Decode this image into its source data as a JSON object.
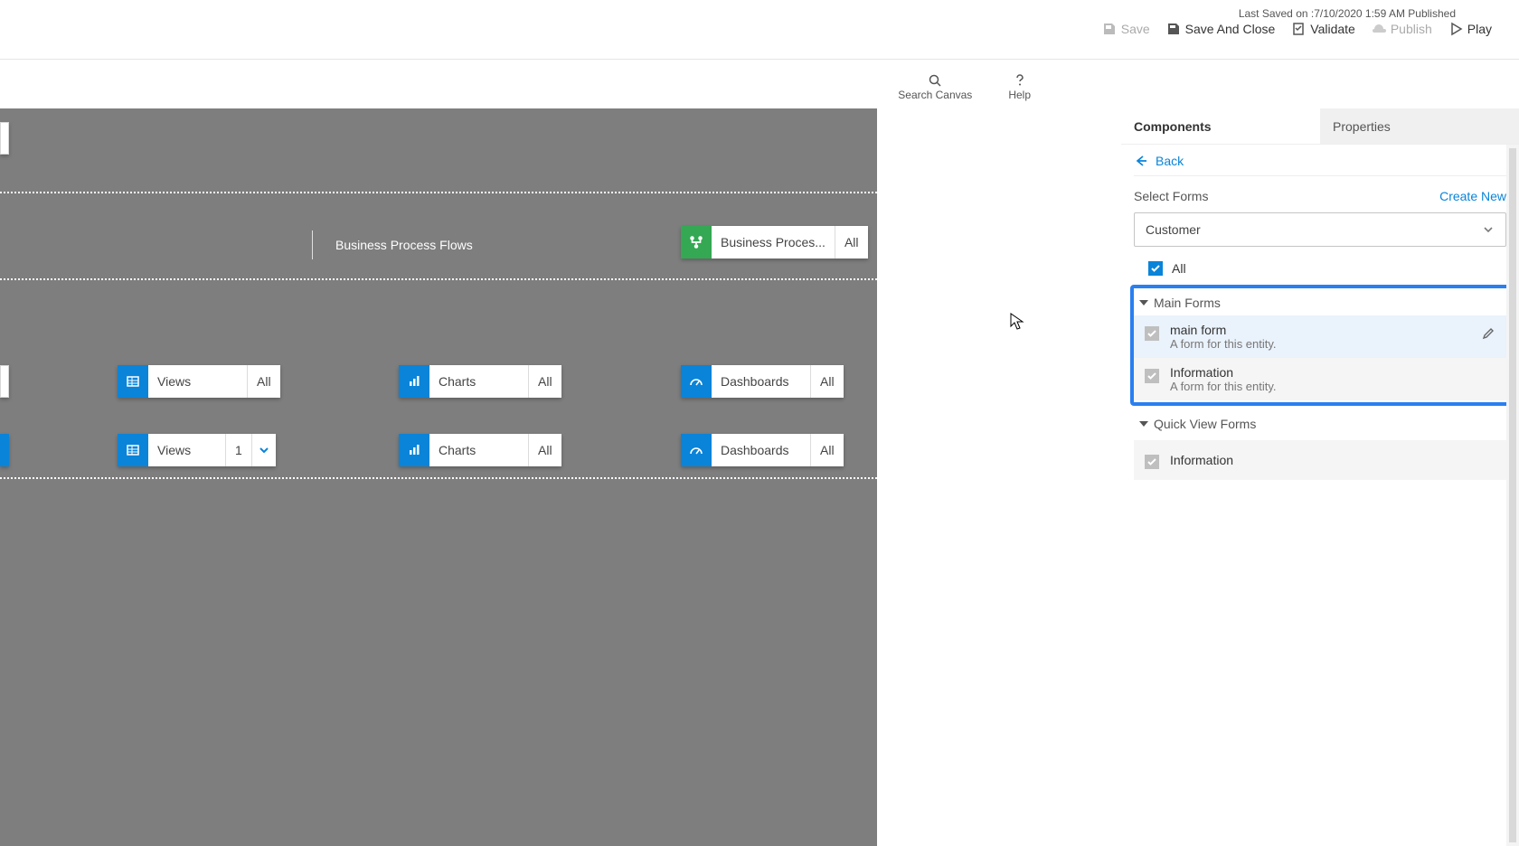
{
  "status_line": "Last Saved on :7/10/2020 1:59 AM Published",
  "toolbar": {
    "save": "Save",
    "save_and_close": "Save And Close",
    "validate": "Validate",
    "publish": "Publish",
    "play": "Play"
  },
  "secondary": {
    "search_canvas": "Search Canvas",
    "help": "Help"
  },
  "canvas": {
    "bpf_label": "Business Process Flows",
    "bpf_tile": {
      "label": "Business Proces...",
      "suffix": "All"
    },
    "row1": {
      "views": {
        "label": "Views",
        "suffix": "All"
      },
      "charts": {
        "label": "Charts",
        "suffix": "All"
      },
      "dashboards": {
        "label": "Dashboards",
        "suffix": "All"
      }
    },
    "row2": {
      "views": {
        "label": "Views",
        "count": "1"
      },
      "charts": {
        "label": "Charts",
        "suffix": "All"
      },
      "dashboards": {
        "label": "Dashboards",
        "suffix": "All"
      }
    }
  },
  "right": {
    "tabs": {
      "components": "Components",
      "properties": "Properties"
    },
    "back": "Back",
    "select_forms": "Select Forms",
    "create_new": "Create New",
    "dropdown_value": "Customer",
    "all_label": "All",
    "main_forms_header": "Main Forms",
    "quick_view_header": "Quick View Forms",
    "main_forms": [
      {
        "title": "main form",
        "desc": "A form for this entity."
      },
      {
        "title": "Information",
        "desc": "A form for this entity."
      }
    ],
    "quick_view_forms": [
      {
        "title": "Information"
      }
    ]
  }
}
